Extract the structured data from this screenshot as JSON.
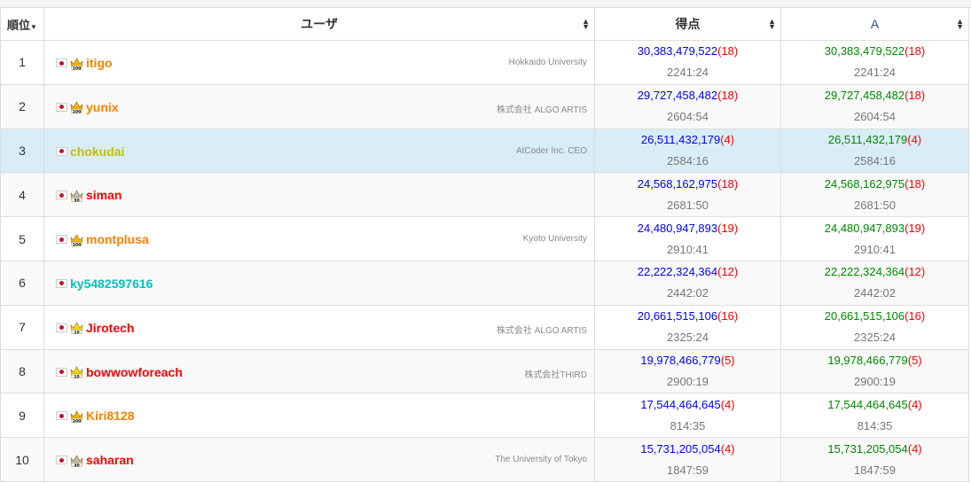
{
  "header": {
    "rank": "順位",
    "user": "ユーザ",
    "score": "得点",
    "task_a": "A"
  },
  "rows": [
    {
      "rank": "1",
      "user": "itigo",
      "aff": "Hokkaido University",
      "crown": "100",
      "color": "c-orange",
      "score": "30,383,479,522",
      "pen": "(18)",
      "time": "2241:24",
      "a_score": "30,383,479,522",
      "a_pen": "(18)",
      "a_time": "2241:24"
    },
    {
      "rank": "2",
      "user": "yunix",
      "aff": "株式会社 ALGO ARTIS",
      "crown": "100",
      "color": "c-orange",
      "score": "29,727,458,482",
      "pen": "(18)",
      "time": "2604:54",
      "a_score": "29,727,458,482",
      "a_pen": "(18)",
      "a_time": "2604:54"
    },
    {
      "rank": "3",
      "user": "chokudai",
      "aff": "AtCoder Inc. CEO",
      "crown": "",
      "color": "c-yellow",
      "score": "26,511,432,179",
      "pen": "(4)",
      "time": "2584:16",
      "a_score": "26,511,432,179",
      "a_pen": "(4)",
      "a_time": "2584:16"
    },
    {
      "rank": "4",
      "user": "siman",
      "aff": "",
      "crown": "30",
      "color": "c-red",
      "score": "24,568,162,975",
      "pen": "(18)",
      "time": "2681:50",
      "a_score": "24,568,162,975",
      "a_pen": "(18)",
      "a_time": "2681:50"
    },
    {
      "rank": "5",
      "user": "montplusa",
      "aff": "Kyoto University",
      "crown": "100",
      "color": "c-orange",
      "score": "24,480,947,893",
      "pen": "(19)",
      "time": "2910:41",
      "a_score": "24,480,947,893",
      "a_pen": "(19)",
      "a_time": "2910:41"
    },
    {
      "rank": "6",
      "user": "ky5482597616",
      "aff": "",
      "crown": "",
      "color": "c-cyan",
      "score": "22,222,324,364",
      "pen": "(12)",
      "time": "2442:02",
      "a_score": "22,222,324,364",
      "a_pen": "(12)",
      "a_time": "2442:02"
    },
    {
      "rank": "7",
      "user": "Jirotech",
      "aff": "株式会社 ALGO ARTIS",
      "crown": "10",
      "color": "c-red",
      "score": "20,661,515,106",
      "pen": "(16)",
      "time": "2325:24",
      "a_score": "20,661,515,106",
      "a_pen": "(16)",
      "a_time": "2325:24"
    },
    {
      "rank": "8",
      "user": "bowwowforeach",
      "aff": "株式会社THIRD",
      "crown": "10",
      "color": "c-red",
      "score": "19,978,466,779",
      "pen": "(5)",
      "time": "2900:19",
      "a_score": "19,978,466,779",
      "a_pen": "(5)",
      "a_time": "2900:19"
    },
    {
      "rank": "9",
      "user": "Kiri8128",
      "aff": "",
      "crown": "100",
      "color": "c-orange",
      "score": "17,544,464,645",
      "pen": "(4)",
      "time": "814:35",
      "a_score": "17,544,464,645",
      "a_pen": "(4)",
      "a_time": "814:35"
    },
    {
      "rank": "10",
      "user": "saharan",
      "aff": "The University of Tokyo",
      "crown": "30",
      "color": "c-red",
      "score": "15,731,205,054",
      "pen": "(4)",
      "time": "1847:59",
      "a_score": "15,731,205,054",
      "a_pen": "(4)",
      "a_time": "1847:59"
    }
  ],
  "highlight_row": "3",
  "colors": {
    "score_blue": "#0000ff",
    "score_green": "#008800",
    "penalty_red": "#ff0000",
    "highlight_bg": "#d9edf7"
  }
}
